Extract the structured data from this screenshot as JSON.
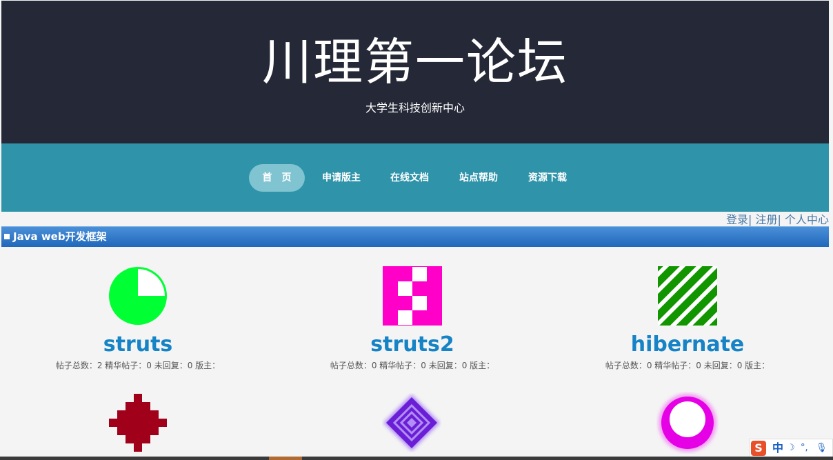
{
  "header": {
    "title": "川理第一论坛",
    "subtitle": "大学生科技创新中心"
  },
  "nav": {
    "items": [
      {
        "label": "首　页",
        "active": true
      },
      {
        "label": "申请版主",
        "active": false
      },
      {
        "label": "在线文档",
        "active": false
      },
      {
        "label": "站点帮助",
        "active": false
      },
      {
        "label": "资源下载",
        "active": false
      }
    ]
  },
  "user_links": {
    "login": "登录",
    "register": "注册",
    "profile": "个人中心",
    "separator": "|"
  },
  "section": {
    "title": "Java web开发框架"
  },
  "boards": [
    {
      "name": "struts",
      "stats": "帖子总数：2 精华帖子：0 未回复：0 版主：",
      "icon": "green-pie-icon",
      "color": "#00ff33"
    },
    {
      "name": "struts2",
      "stats": "帖子总数：0 精华帖子：0 未回复：0 版主：",
      "icon": "magenta-checker-icon",
      "color": "#ff00c8"
    },
    {
      "name": "hibernate",
      "stats": "帖子总数：0 精华帖子：0 未回复：0 版主：",
      "icon": "green-stripes-icon",
      "color": "#129600"
    },
    {
      "name": "",
      "stats": "",
      "icon": "red-diamond-icon",
      "color": "#a0001a"
    },
    {
      "name": "",
      "stats": "",
      "icon": "purple-diamond-icon",
      "color": "#6a1fd6"
    },
    {
      "name": "",
      "stats": "",
      "icon": "magenta-ring-icon",
      "color": "#e600e6"
    }
  ],
  "ime": {
    "logo": "S",
    "mode": "中",
    "moon": "☽",
    "punct": "°,",
    "mic": "🎙"
  }
}
